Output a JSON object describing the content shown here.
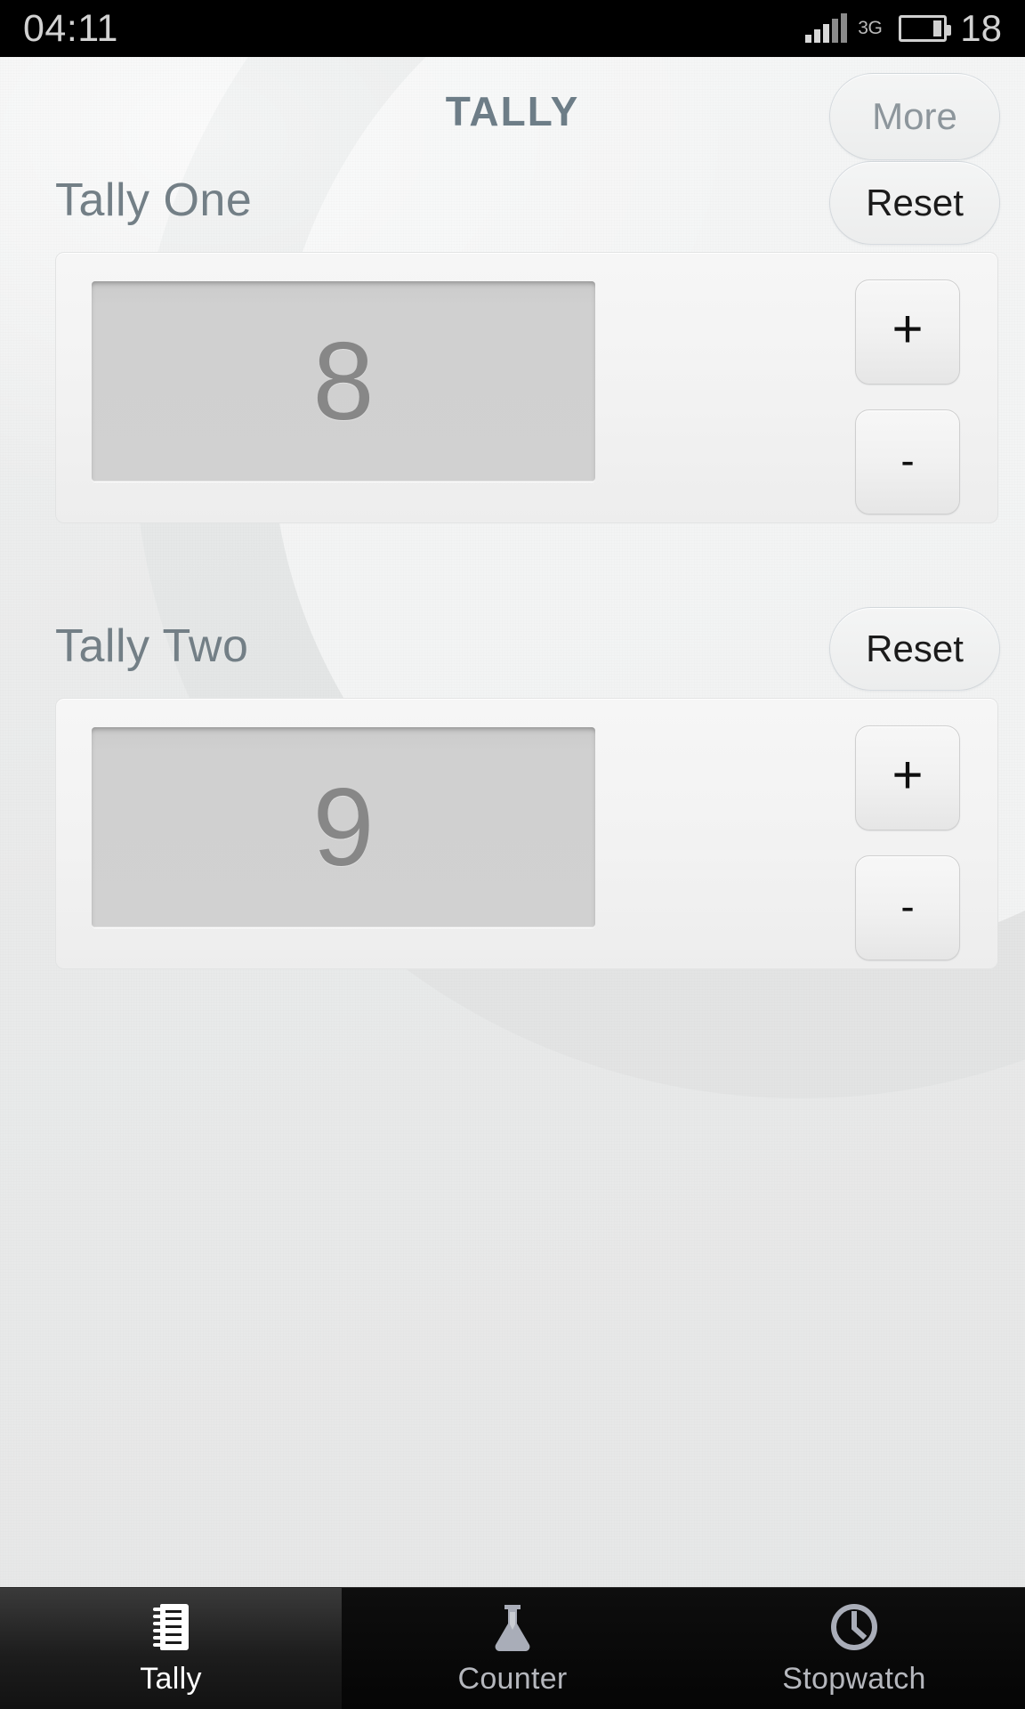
{
  "statusbar": {
    "clock": "04:11",
    "network_type": "3G",
    "battery_percent": "18",
    "signal_icon": "signal-bars-icon",
    "battery_icon": "battery-icon"
  },
  "header": {
    "title": "TALLY",
    "more_label": "More"
  },
  "sections": [
    {
      "title": "Tally One",
      "reset_label": "Reset",
      "value": "8",
      "increment_label": "+",
      "decrement_label": "-"
    },
    {
      "title": "Tally Two",
      "reset_label": "Reset",
      "value": "9",
      "increment_label": "+",
      "decrement_label": "-"
    }
  ],
  "bottom_nav": [
    {
      "label": "Tally",
      "icon": "notepad-icon",
      "active": true
    },
    {
      "label": "Counter",
      "icon": "flask-icon",
      "active": false
    },
    {
      "label": "Stopwatch",
      "icon": "stopwatch-icon",
      "active": false
    }
  ],
  "colors": {
    "title_blue_gray": "#6d7d87",
    "section_label": "#737f86",
    "display_value": "#878787",
    "statusbar_bg": "#000000",
    "nav_bg": "#050505",
    "nav_active_text": "#ffffff",
    "nav_inactive_text": "#b5b7bd",
    "page_bg": "#e9eaea"
  }
}
